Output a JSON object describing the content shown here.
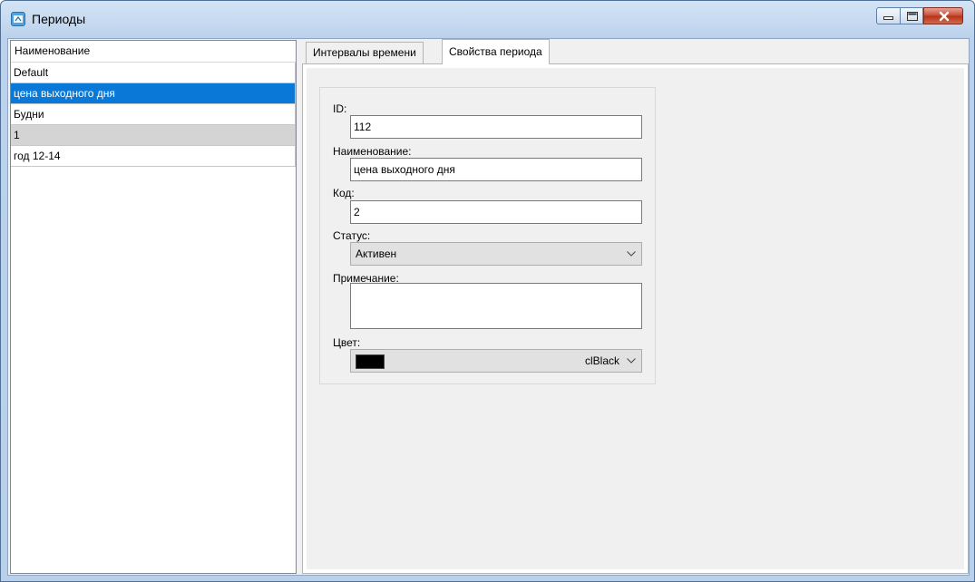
{
  "window": {
    "title": "Периоды",
    "icon": "app-calendar-icon"
  },
  "list": {
    "header": "Наименование",
    "items": [
      {
        "label": "Default",
        "state": "normal"
      },
      {
        "label": "цена выходного дня",
        "state": "selected"
      },
      {
        "label": "Будни",
        "state": "normal"
      },
      {
        "label": "1",
        "state": "gray"
      },
      {
        "label": "год 12-14",
        "state": "normal"
      }
    ]
  },
  "tabs": [
    {
      "label": "Интервалы времени",
      "active": false
    },
    {
      "label": "Свойства периода",
      "active": true
    }
  ],
  "form": {
    "id_label": "ID:",
    "id_value": "112",
    "name_label": "Наименование:",
    "name_value": "цена выходного дня",
    "code_label": "Код:",
    "code_value": "2",
    "status_label": "Статус:",
    "status_value": "Активен",
    "note_label": "Примечание:",
    "note_value": "",
    "color_label": "Цвет:",
    "color_value": "clBlack",
    "color_swatch": "#000000"
  },
  "colors": {
    "selection": "#0a78d7",
    "close_button": "#c9472f"
  }
}
